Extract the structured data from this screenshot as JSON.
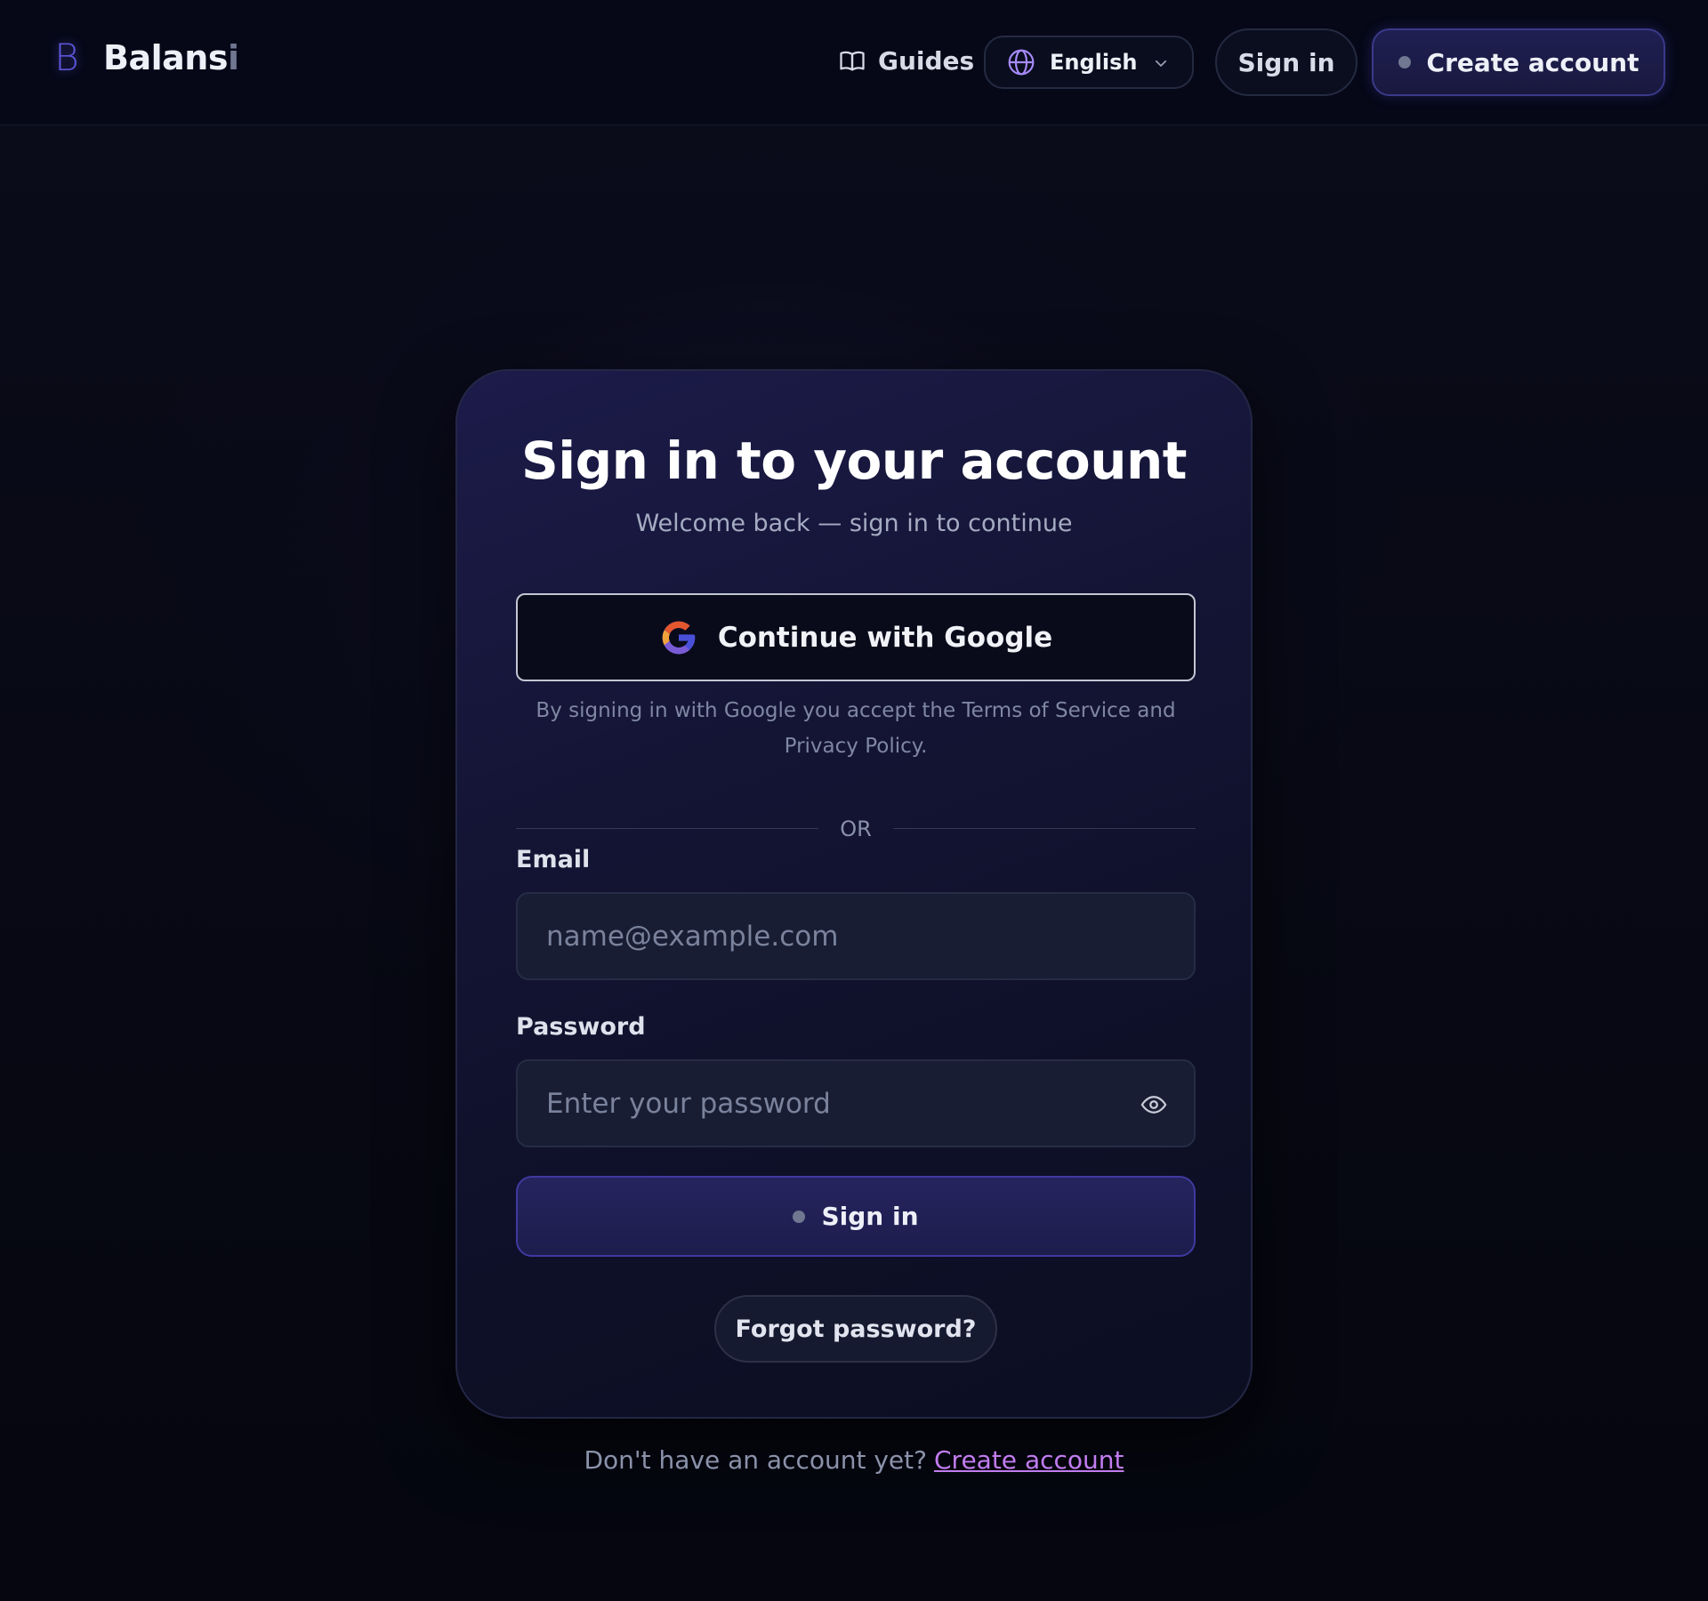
{
  "colors": {
    "background": "#05060f",
    "accent": "#3f3aa0",
    "link": "#c27cf0"
  },
  "header": {
    "brand_logo": "B",
    "brand_name_main": "Balans",
    "brand_name_fade": "i",
    "guides_label": "Guides",
    "guides_icon": "book-icon",
    "language_label": "English",
    "language_icon": "globe-icon",
    "sign_in_label": "Sign in",
    "create_account_label": "Create account"
  },
  "card": {
    "title": "Sign in to your account",
    "subtitle": "Welcome back — sign in to continue",
    "google_button_label": "Continue with Google",
    "google_note": "By signing in with Google you accept the Terms of Service and Privacy Policy.",
    "divider_label": "OR",
    "email": {
      "label": "Email",
      "placeholder": "name@example.com",
      "value": ""
    },
    "password": {
      "label": "Password",
      "placeholder": "Enter your password",
      "value": "",
      "toggle_icon": "eye-icon"
    },
    "sign_in_button_label": "Sign in",
    "forgot_password_label": "Forgot password?"
  },
  "footer": {
    "prompt": "Don't have an account yet?",
    "create_account_link": "Create account"
  }
}
